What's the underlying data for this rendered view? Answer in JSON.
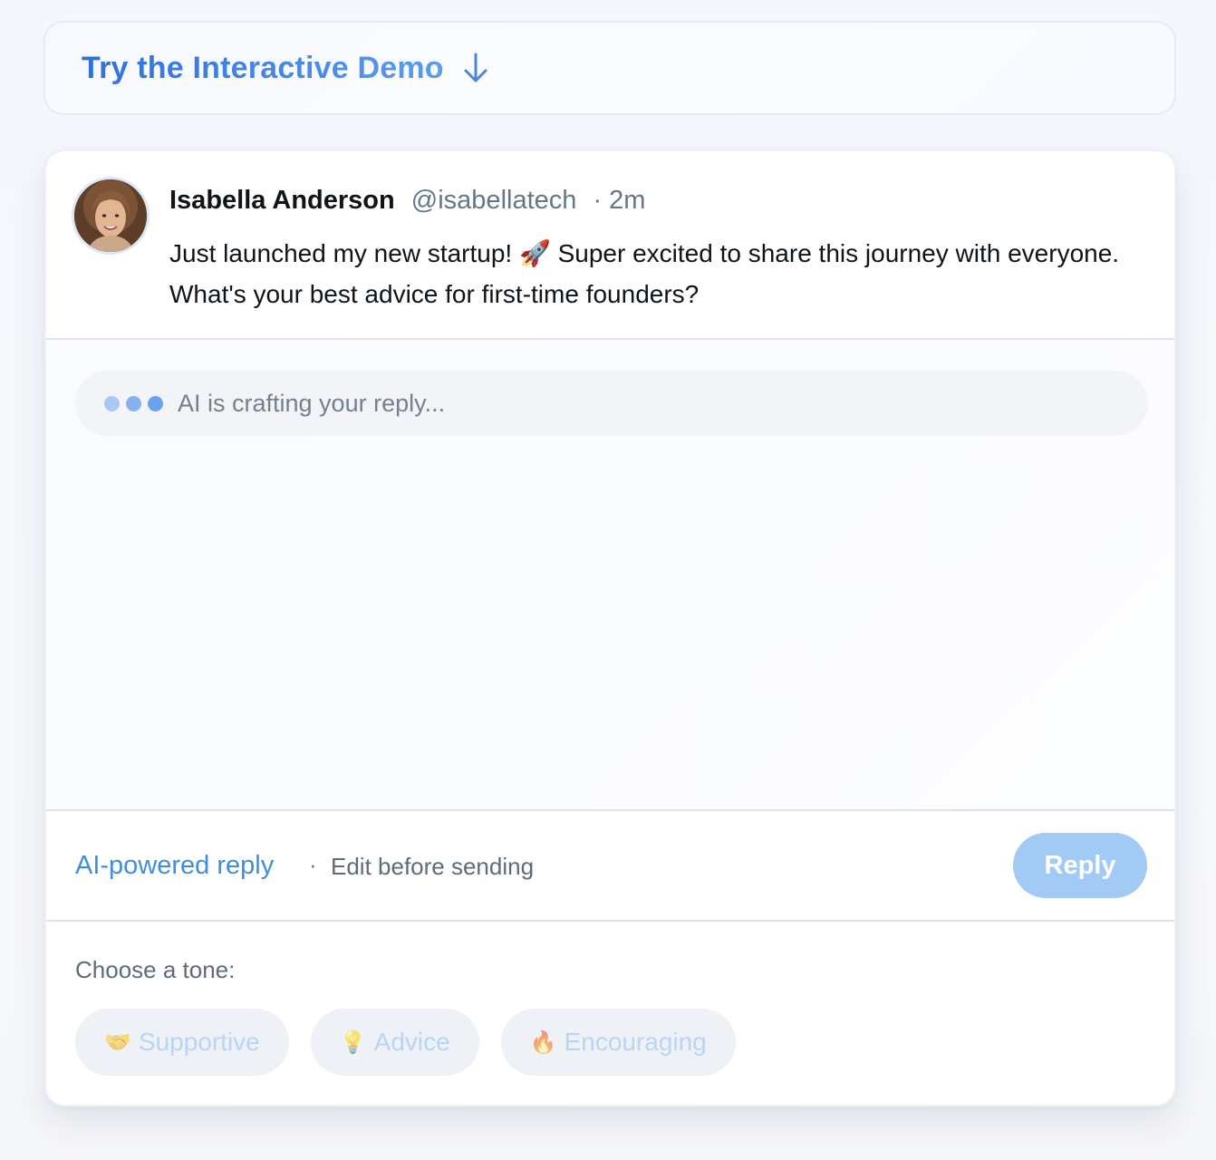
{
  "demo": {
    "title": "Try the Interactive Demo",
    "arrow_icon": "arrow-down-icon"
  },
  "tweet": {
    "author_name": "Isabella Anderson",
    "author_handle": "@isabellatech",
    "separator": "·",
    "time": "2m",
    "text": "Just launched my new startup! 🚀 Super excited to share this journey with everyone. What's your best advice for first-time founders?"
  },
  "composer": {
    "status": "AI is crafting your reply..."
  },
  "meta": {
    "ai_label": "AI-powered reply",
    "separator": "·",
    "edit_hint": "Edit before sending",
    "reply_label": "Reply"
  },
  "tone": {
    "label": "Choose a tone:",
    "options": [
      {
        "emoji": "🤝",
        "label": "Supportive"
      },
      {
        "emoji": "💡",
        "label": "Advice"
      },
      {
        "emoji": "🔥",
        "label": "Encouraging"
      }
    ]
  },
  "colors": {
    "accent": "#3f8ede",
    "reply_button_disabled": "#a3c9f5",
    "chip_text_disabled": "#b9d5f6"
  }
}
